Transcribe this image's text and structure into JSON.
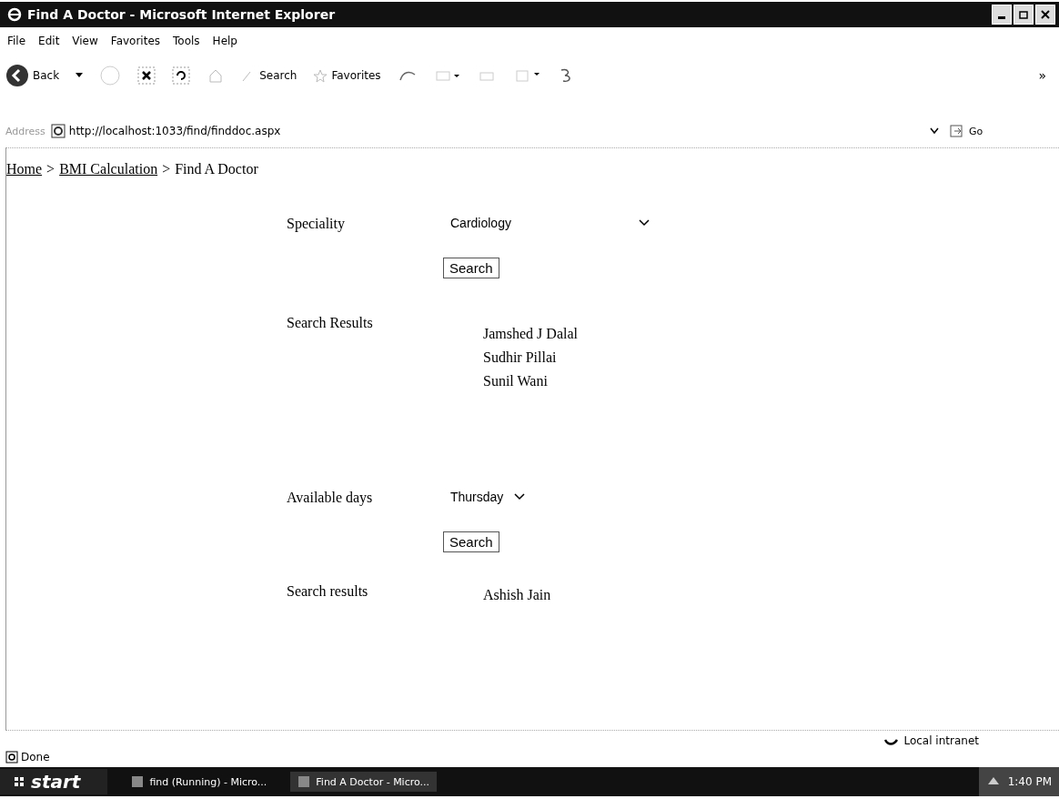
{
  "window": {
    "title": "Find A Doctor - Microsoft Internet Explorer"
  },
  "menu": [
    "File",
    "Edit",
    "View",
    "Favorites",
    "Tools",
    "Help"
  ],
  "toolbar": {
    "back": "Back",
    "search": "Search",
    "favorites": "Favorites",
    "more": "»"
  },
  "address": {
    "label": "Address",
    "url": "http://localhost:1033/find/finddoc.aspx",
    "go": "Go"
  },
  "breadcrumb": {
    "separator": ">",
    "items": [
      {
        "label": "Home",
        "link": true
      },
      {
        "label": "BMI Calculation",
        "link": true
      },
      {
        "label": "Find A Doctor",
        "link": false
      }
    ]
  },
  "sections": [
    {
      "label": "Speciality",
      "value": "Cardiology",
      "button": "Search",
      "results_label": "Search Results",
      "results": [
        "Jamshed J Dalal",
        "Sudhir Pillai",
        "Sunil Wani"
      ],
      "wide": true
    },
    {
      "label": "Available days",
      "value": "Thursday",
      "button": "Search",
      "results_label": "Search results",
      "results": [
        "Ashish Jain"
      ],
      "wide": false
    }
  ],
  "status_bar": {
    "status": "Done",
    "zone": "Local intranet"
  },
  "taskbar": {
    "start": "start",
    "tasks": [
      {
        "label": "find (Running) - Micro...",
        "selected": false
      },
      {
        "label": "Find A Doctor - Micro...",
        "selected": true
      }
    ],
    "clock": "1:40 PM"
  }
}
